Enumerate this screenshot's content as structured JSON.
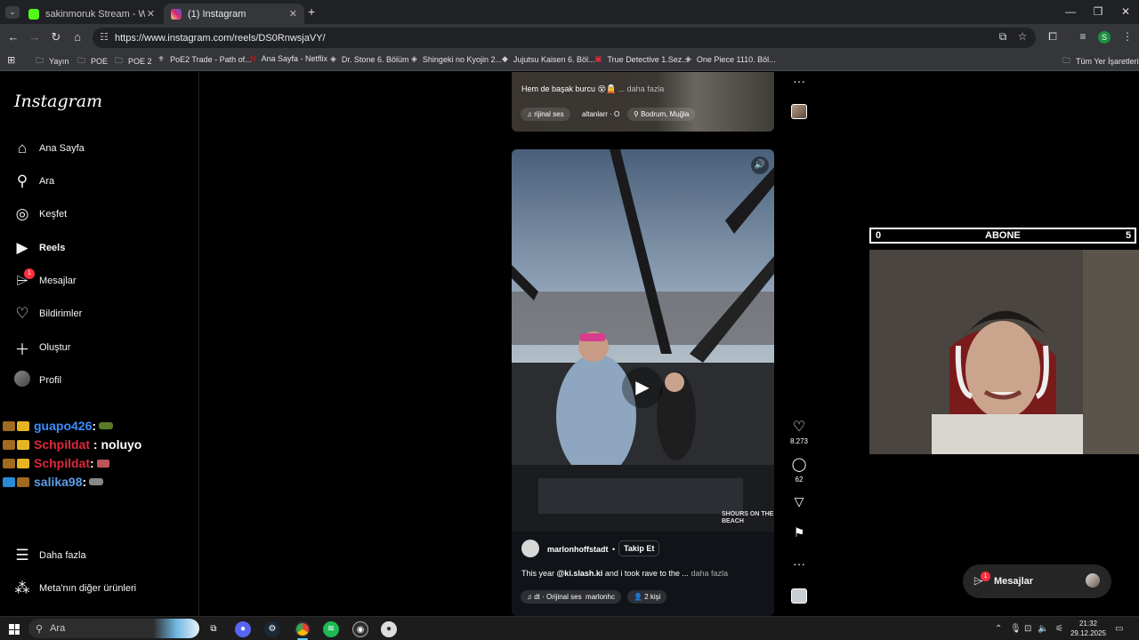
{
  "browser": {
    "tabs": [
      {
        "title": "sakinmoruk Stream - Watch Liv",
        "favicon_color": "#53fc18",
        "active": false
      },
      {
        "title": "(1) Instagram",
        "favicon_color": "#d6249f",
        "active": true
      }
    ],
    "new_tab": "+",
    "url": "https://www.instagram.com/reels/DS0RnwsjaVY/",
    "profile_initial": "S",
    "bookmarks": [
      {
        "label": "Yayın",
        "icon": "folder-icon"
      },
      {
        "label": "POE",
        "icon": "folder-icon"
      },
      {
        "label": "POE 2",
        "icon": "folder-icon"
      },
      {
        "label": "PoE2 Trade - Path of...",
        "icon": "poe-icon"
      },
      {
        "label": "Ana Sayfa - Netflix",
        "icon": "netflix-icon"
      },
      {
        "label": "Dr. Stone 6. Bölüm",
        "icon": "site-icon"
      },
      {
        "label": "Shingeki no Kyojin 2...",
        "icon": "site-icon"
      },
      {
        "label": "Jujutsu Kaisen 6. Böl...",
        "icon": "site-icon"
      },
      {
        "label": "True Detective 1.Sez...",
        "icon": "site-icon"
      },
      {
        "label": "One Piece 1110. Böl...",
        "icon": "site-icon"
      }
    ],
    "all_bookmarks": "Tüm Yer İşaretleri"
  },
  "sidebar": {
    "logo": "Instagram",
    "items": [
      {
        "label": "Ana Sayfa",
        "icon": "home-icon"
      },
      {
        "label": "Ara",
        "icon": "search-icon"
      },
      {
        "label": "Keşfet",
        "icon": "compass-icon"
      },
      {
        "label": "Reels",
        "icon": "reels-icon"
      },
      {
        "label": "Mesajlar",
        "icon": "messenger-icon",
        "badge": "1"
      },
      {
        "label": "Bildirimler",
        "icon": "heart-icon"
      },
      {
        "label": "Oluştur",
        "icon": "plus-icon"
      },
      {
        "label": "Profil",
        "icon": "avatar"
      }
    ],
    "more": "Daha fazla",
    "meta": "Meta'nın diğer ürünleri"
  },
  "chat": [
    {
      "user": "guapo426",
      "msg": "",
      "user_color": "#3b8dff"
    },
    {
      "user": "Schpildat",
      "msg": "noluyo",
      "user_color": "#e0283c"
    },
    {
      "user": "Schpildat",
      "msg": "",
      "user_color": "#e0283c"
    },
    {
      "user": "salika98",
      "msg": "",
      "user_color": "#3b8dff"
    }
  ],
  "prev_reel": {
    "caption": "Hem de başak burcu",
    "more": "... daha fazla",
    "audio": "rijinal ses",
    "audio_user": "altanlarr · O",
    "location": "Bodrum, Muğla"
  },
  "reel": {
    "username": "marlonhoffstadt",
    "dot": "•",
    "follow": "Takip Et",
    "caption_prefix": "This year",
    "caption_mention": "@ki.slash.ki",
    "caption_rest": "and i took rave to the ...",
    "more": "daha fazla",
    "audio": "dt · Orijinal ses",
    "audio_user": "marlonhc",
    "people": "2 kişi",
    "watermark": "SHOURS ON THE BEACH"
  },
  "actions": {
    "likes": "8.273",
    "comments": "62",
    "menu": "···"
  },
  "stream_overlay": {
    "left_num": "0",
    "label": "ABONE",
    "right_num": "5"
  },
  "messages_float": {
    "label": "Mesajlar",
    "badge": "1"
  },
  "taskbar": {
    "search": "Ara",
    "time": "21:32",
    "date": "29.12.2025"
  }
}
